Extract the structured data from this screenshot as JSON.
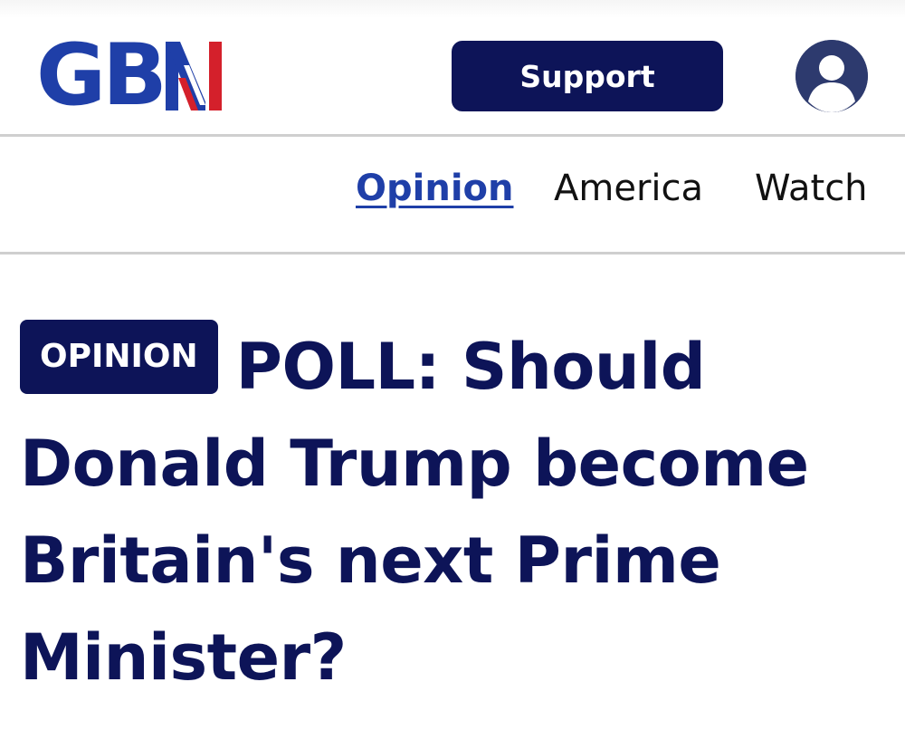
{
  "header": {
    "logo_text": "GB",
    "logo_mark": "news-flag-mark",
    "support_label": "Support",
    "account_icon": "user-icon"
  },
  "nav": {
    "items": [
      {
        "label": "Opinion",
        "active": true
      },
      {
        "label": "America",
        "active": false
      },
      {
        "label": "Watch",
        "active": false
      }
    ]
  },
  "article": {
    "tag": "OPINION",
    "headline": "POLL: Should Donald Trump become Britain's next Prime Minister?"
  },
  "colors": {
    "brand_navy": "#0d1458",
    "brand_blue": "#1f3fa8",
    "brand_red": "#d4202b",
    "divider": "#cfcfcf"
  }
}
